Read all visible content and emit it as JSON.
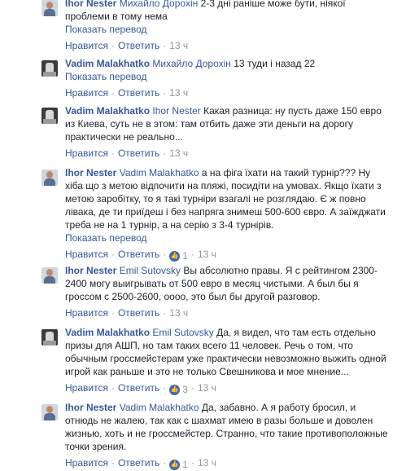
{
  "comments": [
    {
      "author": "Ihor Nester",
      "mention": "Михайло Дорохін",
      "text": " 2-3 дні раніше може бути, ніякої проблеми в тому нема",
      "translate": "Показать перевод",
      "like": "Нравится",
      "reply": "Ответить",
      "time": "13 ч",
      "reactions": ""
    },
    {
      "author": "Vadim Malakhatko",
      "mention": "Михайло Дорохін",
      "text": " 13 туди і назад 22",
      "translate": "Показать перевод",
      "like": "Нравится",
      "reply": "Ответить",
      "time": "13 ч",
      "reactions": ""
    },
    {
      "author": "Vadim Malakhatko",
      "mention": "Ihor Nester",
      "text": " Какая разница: ну пусть даже 150 евро из Киева, суть не в этом: там отбить даже эти деньги на дорогу практически не реально...",
      "translate": "",
      "like": "Нравится",
      "reply": "Ответить",
      "time": "13 ч",
      "reactions": ""
    },
    {
      "author": "Ihor Nester",
      "mention": "Vadim Malakhatko",
      "text": " а на фіга їхати на такий турнір??? Ну хіба що з метою відпочити на пляжі, посидіти на умовах. Якщо їхати з метою заробітку, то я такі турніри взагалі не розглядаю. Є ж повно лівака, де ти приїдеш і без напряга знимеш 500-600 євро. А заїжджати треба не на 1 турнір, а на серію з 3-4 турнірів.",
      "translate": "Показать перевод",
      "like": "Нравится",
      "reply": "Ответить",
      "time": "13 ч",
      "reactions": "1"
    },
    {
      "author": "Ihor Nester",
      "mention": "Emil Sutovsky",
      "text": " Вы абсолютно правы. Я с рейтингом 2300-2400 могу выигрывать от 500 евро в месяц чистыми. А был бы я гроссом с 2500-2600, оооо, это был бы другой разговор.",
      "translate": "",
      "like": "Нравится",
      "reply": "Ответить",
      "time": "13 ч",
      "reactions": ""
    },
    {
      "author": "Vadim Malakhatko",
      "mention": "Emil Sutovsky",
      "text": " Да, я видел, что там есть отдельно призы для АШП, но там таких всего 11 человек. Речь о том, что обычным гроссмейстерам уже практически невозможно выжить одной игрой как раньше и это не только Свешникова и мое мнение...",
      "translate": "",
      "like": "Нравится",
      "reply": "Ответить",
      "time": "13 ч",
      "reactions": "3"
    },
    {
      "author": "Ihor Nester",
      "mention": "Vadim Malakhatko",
      "text": " Да, забавно. А я работу бросил, и отнюдь не жалею, так как с шахмат имею в разы больше и доволен жизнью, хоть и не гроссмейстер. Странно, что такие противоположные точки зрения.",
      "translate": "",
      "like": "Нравится",
      "reply": "Ответить",
      "time": "13 ч",
      "reactions": "1"
    }
  ]
}
